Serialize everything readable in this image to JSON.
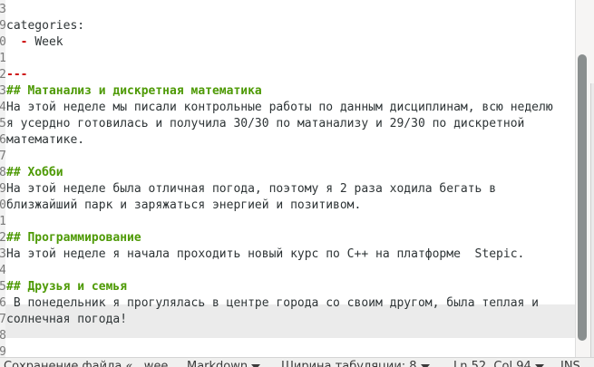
{
  "gutter": {
    "numbers": [
      "3",
      "9",
      "0",
      "1",
      "2",
      "3",
      "4",
      "5",
      "6",
      "7",
      "8",
      "9",
      "0",
      "1",
      "2",
      "3",
      "4",
      "5",
      "6",
      "7",
      "8",
      "9",
      "0"
    ]
  },
  "document": {
    "lines": [
      {
        "text": "",
        "style": "plain"
      },
      {
        "text": "categories:",
        "style": "plain"
      },
      {
        "text": "Week",
        "style": "bullet",
        "prefix": "  - "
      },
      {
        "text": "",
        "style": "plain"
      },
      {
        "text": "---",
        "style": "hr"
      },
      {
        "text": "## Матанализ и дискретная математика",
        "style": "heading"
      },
      {
        "text": "На этой неделе мы писали контрольные работы по данным дисциплинам, всю неделю",
        "style": "plain"
      },
      {
        "text": "я усердно готовилась и получила 30/30 по матанализу и 29/30 по дискретной",
        "style": "plain"
      },
      {
        "text": "математике.",
        "style": "plain"
      },
      {
        "text": "",
        "style": "plain"
      },
      {
        "text": "## Хобби",
        "style": "heading"
      },
      {
        "text": "На этой неделе была отличная погода, поэтому я 2 раза ходила бегать в",
        "style": "plain"
      },
      {
        "text": "близжайший парк и заряжаться энергией и позитивом.",
        "style": "plain"
      },
      {
        "text": "",
        "style": "plain"
      },
      {
        "text": "## Программирование",
        "style": "heading"
      },
      {
        "text": "На этой неделе я начала проходить новый курс по С++ на платформе  Stepic.",
        "style": "plain"
      },
      {
        "text": "",
        "style": "plain"
      },
      {
        "text": "## Друзья и семья",
        "style": "heading"
      },
      {
        "text": " В понедельник я прогулялась в центре города со своим другом, была теплая и",
        "style": "plain"
      },
      {
        "text": "солнечная погода!",
        "style": "plain"
      }
    ]
  },
  "statusbar": {
    "save_status": "Сохранение файла «...wee",
    "language": "Markdown",
    "tab_width": "Ширина табуляции: 8",
    "position": "Ln 52, Col 94",
    "mode": "INS"
  },
  "colors": {
    "heading": "#4e9a06",
    "list_marker": "#cc0000",
    "text": "#2e3436",
    "current_line_bg": "#ebebeb"
  }
}
